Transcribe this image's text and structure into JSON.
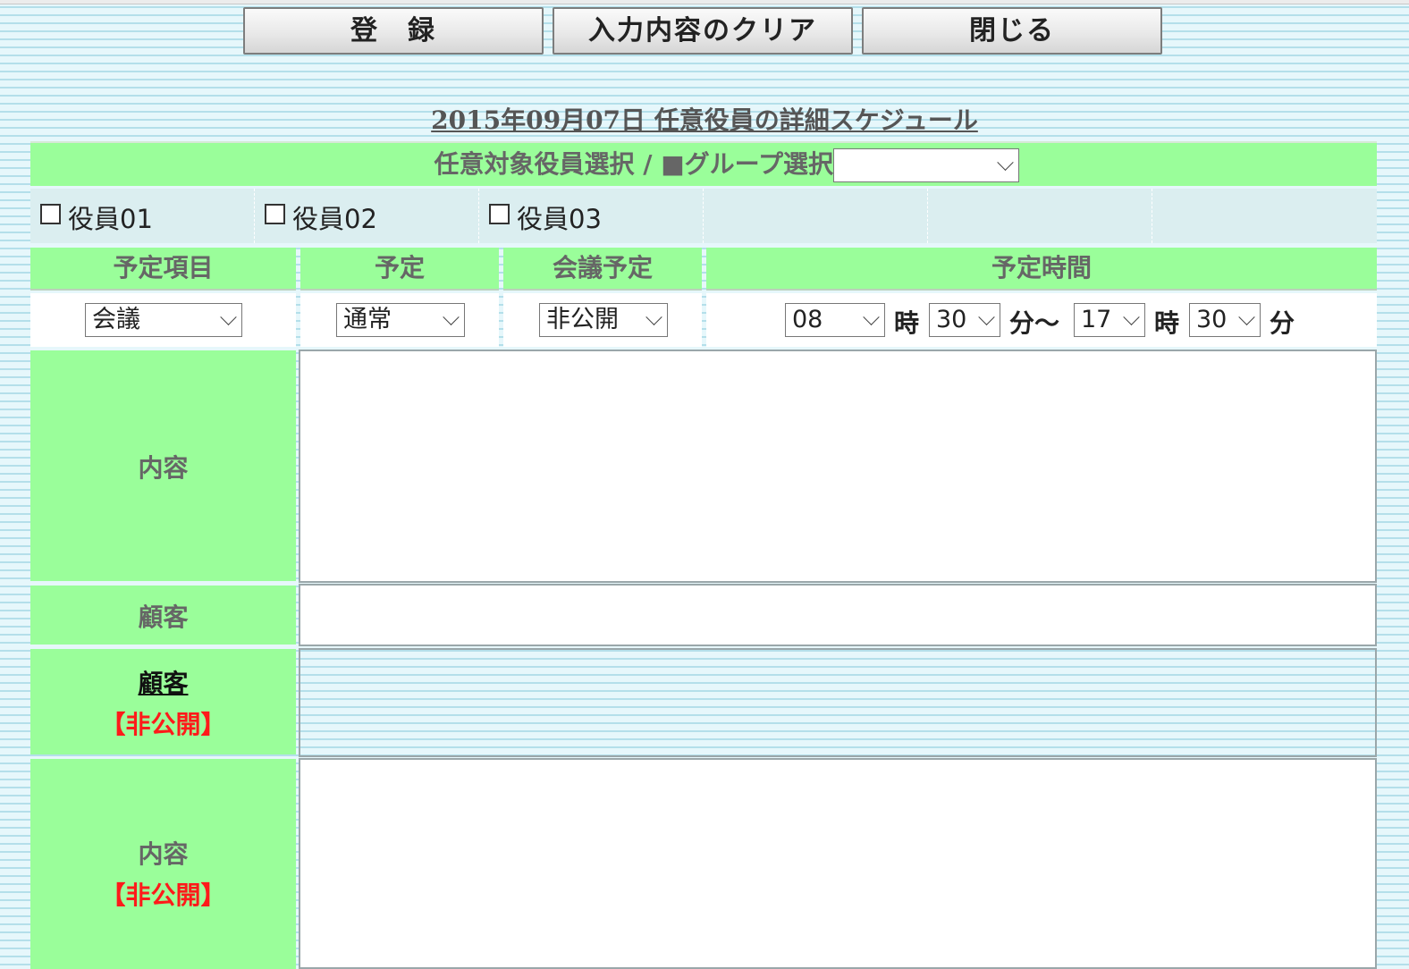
{
  "toolbar": {
    "register_label": "登　録",
    "clear_label": "入力内容のクリア",
    "close_label": "閉じる"
  },
  "page_title": "2015年09月07日 任意役員の詳細スケジュール",
  "group_select": {
    "label": "任意対象役員選択 / ■グループ選択",
    "value": ""
  },
  "members": [
    {
      "label": "役員01",
      "checked": false
    },
    {
      "label": "役員02",
      "checked": false
    },
    {
      "label": "役員03",
      "checked": false
    }
  ],
  "schedule_headers": {
    "item": "予定項目",
    "plan": "予定",
    "meeting": "会議予定",
    "time": "予定時間"
  },
  "schedule_values": {
    "item": "会議",
    "plan": "通常",
    "meeting": "非公開",
    "start_hour": "08",
    "start_min": "30",
    "end_hour": "17",
    "end_min": "30"
  },
  "time_units": {
    "hour": "時",
    "min_to": "分～",
    "min": "分"
  },
  "fields": {
    "content_label": "内容",
    "customer_label": "顧客",
    "private_customer_label": "顧客",
    "private_content_label": "内容",
    "private_tag": "【非公開】",
    "content_value": "",
    "customer_value": "",
    "private_content_value": ""
  }
}
